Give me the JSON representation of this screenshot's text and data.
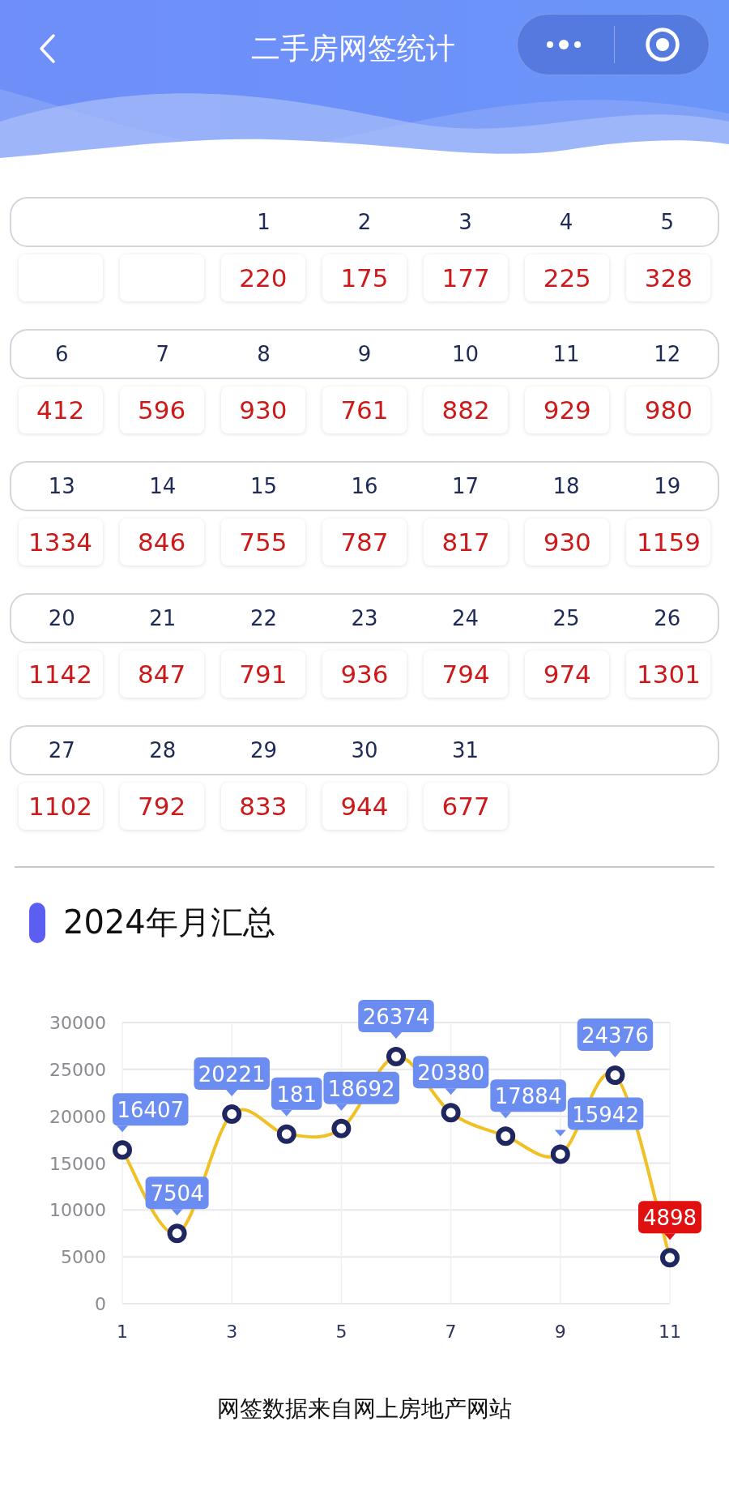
{
  "header": {
    "title": "二手房网签统计"
  },
  "calendar": {
    "weeks": [
      {
        "days": [
          {
            "kind": "blank"
          },
          {
            "kind": "blank"
          },
          {
            "kind": "day",
            "day": "1",
            "count": "220"
          },
          {
            "kind": "day",
            "day": "2",
            "count": "175"
          },
          {
            "kind": "day",
            "day": "3",
            "count": "177"
          },
          {
            "kind": "day",
            "day": "4",
            "count": "225"
          },
          {
            "kind": "day",
            "day": "5",
            "count": "328"
          }
        ]
      },
      {
        "days": [
          {
            "kind": "day",
            "day": "6",
            "count": "412"
          },
          {
            "kind": "day",
            "day": "7",
            "count": "596"
          },
          {
            "kind": "day",
            "day": "8",
            "count": "930"
          },
          {
            "kind": "day",
            "day": "9",
            "count": "761"
          },
          {
            "kind": "day",
            "day": "10",
            "count": "882"
          },
          {
            "kind": "day",
            "day": "11",
            "count": "929"
          },
          {
            "kind": "day",
            "day": "12",
            "count": "980"
          }
        ]
      },
      {
        "days": [
          {
            "kind": "day",
            "day": "13",
            "count": "1334"
          },
          {
            "kind": "day",
            "day": "14",
            "count": "846"
          },
          {
            "kind": "day",
            "day": "15",
            "count": "755"
          },
          {
            "kind": "day",
            "day": "16",
            "count": "787"
          },
          {
            "kind": "day",
            "day": "17",
            "count": "817"
          },
          {
            "kind": "day",
            "day": "18",
            "count": "930"
          },
          {
            "kind": "day",
            "day": "19",
            "count": "1159"
          }
        ]
      },
      {
        "days": [
          {
            "kind": "day",
            "day": "20",
            "count": "1142"
          },
          {
            "kind": "day",
            "day": "21",
            "count": "847"
          },
          {
            "kind": "day",
            "day": "22",
            "count": "791"
          },
          {
            "kind": "day",
            "day": "23",
            "count": "936"
          },
          {
            "kind": "day",
            "day": "24",
            "count": "794"
          },
          {
            "kind": "day",
            "day": "25",
            "count": "974"
          },
          {
            "kind": "day",
            "day": "26",
            "count": "1301"
          }
        ]
      },
      {
        "days": [
          {
            "kind": "day",
            "day": "27",
            "count": "1102"
          },
          {
            "kind": "day",
            "day": "28",
            "count": "792"
          },
          {
            "kind": "day",
            "day": "29",
            "count": "833"
          },
          {
            "kind": "day",
            "day": "30",
            "count": "944"
          },
          {
            "kind": "day",
            "day": "31",
            "count": "677"
          }
        ]
      }
    ]
  },
  "summary": {
    "title": "2024年月汇总",
    "chart_data": {
      "type": "line",
      "x": [
        1,
        2,
        3,
        4,
        5,
        6,
        7,
        8,
        9,
        10,
        11
      ],
      "grid": true,
      "series": [
        {
          "color": "#f0c024",
          "marker": true,
          "values": [
            16407,
            7504,
            20221,
            18100,
            18692,
            26374,
            20380,
            17884,
            15942,
            24376,
            4898
          ]
        }
      ],
      "xlim": [
        1,
        11
      ],
      "ylim": [
        0,
        30000
      ],
      "xticks": [
        1,
        3,
        5,
        7,
        9,
        11
      ],
      "yticks": [
        0,
        5000,
        10000,
        15000,
        20000,
        25000,
        30000
      ],
      "value_labels": [
        {
          "text": "16407",
          "color": "#6b8cf0"
        },
        {
          "text": "7504",
          "color": "#6b8cf0"
        },
        {
          "text": "20221",
          "color": "#6b8cf0"
        },
        {
          "text": "181",
          "color": "#6b8cf0"
        },
        {
          "text": "18692",
          "color": "#6b8cf0"
        },
        {
          "text": "26374",
          "color": "#6b8cf0"
        },
        {
          "text": "20380",
          "color": "#6b8cf0"
        },
        {
          "text": "17884",
          "color": "#6b8cf0"
        },
        {
          "text": "15942",
          "color": "#6b8cf0"
        },
        {
          "text": "24376",
          "color": "#6b8cf0"
        },
        {
          "text": "4898",
          "color": "#e01010"
        }
      ]
    }
  },
  "footer": {
    "note": "网签数据来自网上房地产网站"
  }
}
